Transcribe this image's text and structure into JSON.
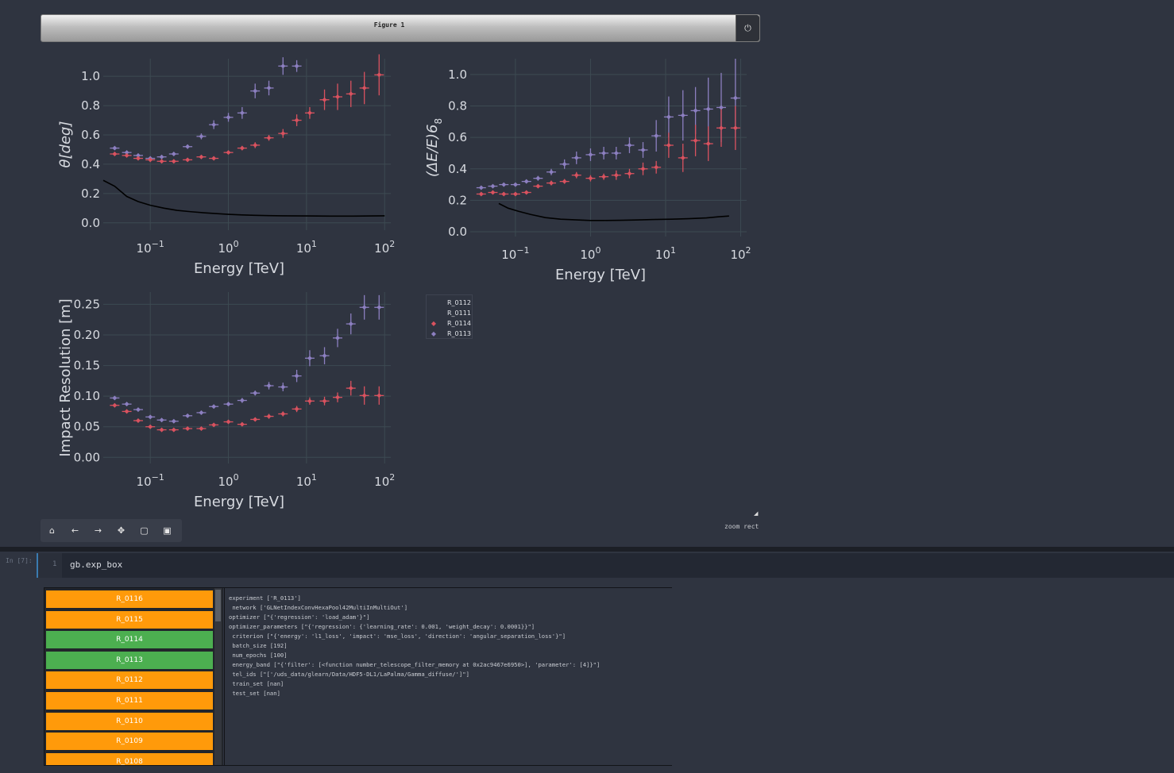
{
  "figure": {
    "title": "Figure 1",
    "close_icon": "power-icon"
  },
  "colors": {
    "R_0114": "#d9525f",
    "R_0113": "#8c7fc0",
    "baseline": "#000000",
    "orange": "#ff9a0a",
    "green": "#4caf50"
  },
  "chart_data": [
    {
      "type": "scatter",
      "title": "",
      "xlabel": "Energy [TeV]",
      "ylabel": "θ[deg]",
      "xscale": "log",
      "xlim": [
        0.025,
        120
      ],
      "ylim": [
        -0.05,
        1.12
      ],
      "x_ticks": [
        "10−1",
        "100",
        "101",
        "102"
      ],
      "y_ticks": [
        "0.0",
        "0.2",
        "0.4",
        "0.6",
        "0.8",
        "1.0"
      ],
      "grid": true,
      "series": [
        {
          "name": "R_0113",
          "marker": "diamond",
          "x": [
            0.035,
            0.05,
            0.07,
            0.1,
            0.14,
            0.2,
            0.3,
            0.45,
            0.65,
            1.0,
            1.5,
            2.2,
            3.3,
            5,
            7.5
          ],
          "y": [
            0.51,
            0.48,
            0.46,
            0.44,
            0.45,
            0.47,
            0.52,
            0.59,
            0.67,
            0.72,
            0.75,
            0.9,
            0.92,
            1.07,
            1.07
          ],
          "yerr": [
            0.01,
            0.01,
            0.01,
            0.01,
            0.01,
            0.01,
            0.015,
            0.02,
            0.03,
            0.03,
            0.04,
            0.05,
            0.05,
            0.06,
            0.04
          ]
        },
        {
          "name": "R_0114",
          "marker": "diamond",
          "x": [
            0.035,
            0.05,
            0.07,
            0.1,
            0.14,
            0.2,
            0.3,
            0.45,
            0.65,
            1.0,
            1.5,
            2.2,
            3.3,
            5,
            7.5,
            11,
            17,
            25,
            37,
            55,
            85
          ],
          "y": [
            0.47,
            0.46,
            0.44,
            0.43,
            0.42,
            0.42,
            0.43,
            0.45,
            0.44,
            0.48,
            0.51,
            0.53,
            0.58,
            0.61,
            0.7,
            0.75,
            0.84,
            0.86,
            0.88,
            0.92,
            1.01
          ],
          "yerr": [
            0.01,
            0.01,
            0.01,
            0.01,
            0.01,
            0.01,
            0.01,
            0.01,
            0.01,
            0.01,
            0.015,
            0.02,
            0.02,
            0.03,
            0.04,
            0.04,
            0.07,
            0.09,
            0.09,
            0.11,
            0.14
          ]
        },
        {
          "name": "",
          "type": "line",
          "x": [
            0.025,
            0.035,
            0.05,
            0.07,
            0.1,
            0.15,
            0.22,
            0.33,
            0.5,
            0.75,
            1.0,
            1.5,
            2.2,
            3.3,
            5,
            10,
            20,
            40,
            70,
            100
          ],
          "y": [
            0.29,
            0.25,
            0.18,
            0.145,
            0.12,
            0.1,
            0.085,
            0.076,
            0.068,
            0.062,
            0.058,
            0.054,
            0.051,
            0.049,
            0.048,
            0.047,
            0.046,
            0.046,
            0.047,
            0.048
          ]
        }
      ]
    },
    {
      "type": "scatter",
      "title": "",
      "xlabel": "Energy [TeV]",
      "ylabel": "(ΔE/E)68",
      "xscale": "log",
      "xlim": [
        0.025,
        120
      ],
      "ylim": [
        -0.03,
        1.1
      ],
      "x_ticks": [
        "10−1",
        "100",
        "101",
        "102"
      ],
      "y_ticks": [
        "0.0",
        "0.2",
        "0.4",
        "0.6",
        "0.8",
        "1.0"
      ],
      "grid": true,
      "series": [
        {
          "name": "R_0113",
          "marker": "diamond",
          "x": [
            0.035,
            0.05,
            0.07,
            0.1,
            0.14,
            0.2,
            0.3,
            0.45,
            0.65,
            1.0,
            1.5,
            2.2,
            3.3,
            5,
            7.5,
            11,
            17,
            25,
            37,
            55,
            85
          ],
          "y": [
            0.28,
            0.29,
            0.3,
            0.3,
            0.32,
            0.34,
            0.38,
            0.43,
            0.47,
            0.49,
            0.5,
            0.5,
            0.55,
            0.52,
            0.61,
            0.73,
            0.74,
            0.77,
            0.78,
            0.79,
            0.85
          ],
          "yerr": [
            0.01,
            0.01,
            0.01,
            0.01,
            0.01,
            0.015,
            0.02,
            0.03,
            0.04,
            0.04,
            0.04,
            0.04,
            0.05,
            0.05,
            0.1,
            0.13,
            0.16,
            0.15,
            0.2,
            0.22,
            0.25
          ]
        },
        {
          "name": "R_0114",
          "marker": "diamond",
          "x": [
            0.035,
            0.05,
            0.07,
            0.1,
            0.14,
            0.2,
            0.3,
            0.45,
            0.65,
            1.0,
            1.5,
            2.2,
            3.3,
            5,
            7.5,
            11,
            17,
            25,
            37,
            55,
            85
          ],
          "y": [
            0.24,
            0.25,
            0.24,
            0.24,
            0.25,
            0.29,
            0.31,
            0.32,
            0.36,
            0.34,
            0.35,
            0.36,
            0.37,
            0.4,
            0.41,
            0.55,
            0.47,
            0.58,
            0.56,
            0.66,
            0.66
          ],
          "yerr": [
            0.01,
            0.01,
            0.01,
            0.01,
            0.01,
            0.01,
            0.015,
            0.015,
            0.02,
            0.02,
            0.02,
            0.03,
            0.03,
            0.04,
            0.04,
            0.08,
            0.09,
            0.1,
            0.11,
            0.12,
            0.14
          ]
        },
        {
          "name": "",
          "type": "line",
          "x": [
            0.06,
            0.08,
            0.11,
            0.16,
            0.25,
            0.4,
            0.7,
            1,
            1.5,
            2.5,
            4,
            7,
            12,
            20,
            35,
            50,
            70
          ],
          "y": [
            0.18,
            0.15,
            0.13,
            0.11,
            0.09,
            0.08,
            0.075,
            0.072,
            0.072,
            0.073,
            0.075,
            0.078,
            0.08,
            0.083,
            0.088,
            0.095,
            0.1
          ]
        }
      ]
    },
    {
      "type": "scatter",
      "title": "",
      "xlabel": "Energy [TeV]",
      "ylabel": "Impact Resolution [m]",
      "xscale": "log",
      "xlim": [
        0.025,
        120
      ],
      "ylim": [
        -0.01,
        0.27
      ],
      "x_ticks": [
        "10−1",
        "100",
        "101",
        "102"
      ],
      "y_ticks": [
        "0.00",
        "0.05",
        "0.10",
        "0.15",
        "0.20",
        "0.25"
      ],
      "grid": true,
      "series": [
        {
          "name": "R_0113",
          "marker": "diamond",
          "x": [
            0.035,
            0.05,
            0.07,
            0.1,
            0.14,
            0.2,
            0.3,
            0.45,
            0.65,
            1.0,
            1.5,
            2.2,
            3.3,
            5,
            7.5,
            11,
            17,
            25,
            37,
            55,
            85
          ],
          "y": [
            0.097,
            0.087,
            0.078,
            0.066,
            0.061,
            0.059,
            0.068,
            0.073,
            0.083,
            0.087,
            0.093,
            0.105,
            0.117,
            0.115,
            0.133,
            0.162,
            0.166,
            0.195,
            0.218,
            0.245,
            0.245
          ],
          "yerr": [
            0.002,
            0.002,
            0.002,
            0.002,
            0.002,
            0.002,
            0.002,
            0.003,
            0.003,
            0.003,
            0.004,
            0.004,
            0.006,
            0.007,
            0.01,
            0.013,
            0.014,
            0.015,
            0.017,
            0.02,
            0.02
          ]
        },
        {
          "name": "R_0114",
          "marker": "diamond",
          "x": [
            0.035,
            0.05,
            0.07,
            0.1,
            0.14,
            0.2,
            0.3,
            0.45,
            0.65,
            1.0,
            1.5,
            2.2,
            3.3,
            5,
            7.5,
            11,
            17,
            25,
            37,
            55,
            85
          ],
          "y": [
            0.085,
            0.075,
            0.06,
            0.05,
            0.045,
            0.045,
            0.047,
            0.047,
            0.053,
            0.058,
            0.054,
            0.062,
            0.067,
            0.071,
            0.079,
            0.092,
            0.092,
            0.098,
            0.113,
            0.101,
            0.101
          ],
          "yerr": [
            0.002,
            0.002,
            0.002,
            0.002,
            0.002,
            0.002,
            0.002,
            0.002,
            0.002,
            0.003,
            0.003,
            0.003,
            0.004,
            0.004,
            0.005,
            0.006,
            0.007,
            0.008,
            0.012,
            0.015,
            0.015
          ]
        }
      ]
    }
  ],
  "legend": {
    "items": [
      {
        "label": "R_0112",
        "marker": "",
        "color": ""
      },
      {
        "label": "R_0111",
        "marker": "",
        "color": ""
      },
      {
        "label": "R_0114",
        "marker": "◆",
        "color": "#d9525f"
      },
      {
        "label": "R_0113",
        "marker": "◆",
        "color": "#8c7fc0"
      }
    ]
  },
  "toolbar": {
    "buttons": [
      {
        "name": "home-icon",
        "glyph": "⌂"
      },
      {
        "name": "back-arrow-icon",
        "glyph": "←"
      },
      {
        "name": "forward-arrow-icon",
        "glyph": "→"
      },
      {
        "name": "move-icon",
        "glyph": "✥"
      },
      {
        "name": "zoom-rect-icon",
        "glyph": "▢"
      },
      {
        "name": "save-icon",
        "glyph": "💾"
      }
    ],
    "mode_label": "zoom rect"
  },
  "cell": {
    "prompt": "In [7]:",
    "line_number": "1",
    "code": "gb.exp_box"
  },
  "experiments": [
    {
      "label": "R_0116",
      "status": "orange"
    },
    {
      "label": "R_0115",
      "status": "orange"
    },
    {
      "label": "R_0114",
      "status": "green"
    },
    {
      "label": "R_0113",
      "status": "green"
    },
    {
      "label": "R_0112",
      "status": "orange"
    },
    {
      "label": "R_0111",
      "status": "orange"
    },
    {
      "label": "R_0110",
      "status": "orange"
    },
    {
      "label": "R_0109",
      "status": "orange"
    },
    {
      "label": "R_0108",
      "status": "orange"
    }
  ],
  "details": {
    "lines": [
      "experiment ['R_0113']",
      " network ['GLNetIndexConvHexaPool42MultiInMultiOut']",
      "optimizer [\"{'regression': 'load_adam'}\"]",
      "optimizer_parameters [\"{'regression': {'learning_rate': 0.001, 'weight_decay': 0.0001}}\"]",
      " criterion [\"{'energy': 'l1_loss', 'impact': 'mse_loss', 'direction': 'angular_separation_loss'}\"]",
      " batch_size [192]",
      " num_epochs [100]",
      " energy_band [\"{'filter': [<function number_telescope_filter_memory at 0x2ac9467e6950>], 'parameter': [4]}\"]",
      " tel_ids [\"['/uds_data/glearn/Data/HDF5-DL1/LaPalma/Gamma_diffuse/']\"]",
      " train_set [nan]",
      " test_set [nan]"
    ]
  }
}
